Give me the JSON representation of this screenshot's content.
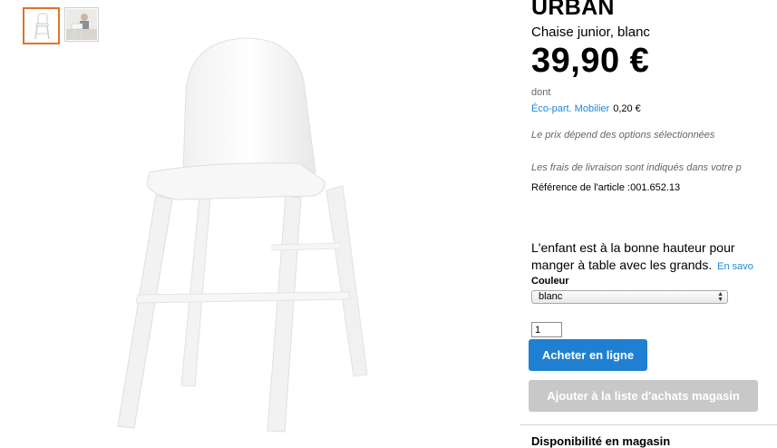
{
  "product": {
    "name": "URBAN",
    "subtitle": "Chaise junior, blanc",
    "price": "39,90 €"
  },
  "eco": {
    "dont": "dont",
    "link": "Éco-part. Mobilier",
    "value": "0,20 €"
  },
  "notes": {
    "price_options": "Le prix dépend des options sélectionnées",
    "shipping": "Les frais de livraison sont indiqués dans votre p"
  },
  "reference": "Référence de l'article :001.652.13",
  "description": {
    "line1": "L'enfant est à la bonne hauteur pour",
    "line2": "manger à table avec les grands.",
    "more_link": "En savo"
  },
  "color": {
    "label": "Couleur",
    "selected": "blanc"
  },
  "quantity": "1",
  "buttons": {
    "buy": "Acheter en ligne",
    "add_list": "Ajouter à la liste d'achats magasin"
  },
  "bottom": {
    "partial": "Disponibilité en magasin"
  },
  "icons": {
    "select_arrows": "updown-arrows-icon",
    "thumb_chair": "chair-thumbnail",
    "thumb_scene": "scene-thumbnail"
  },
  "colors": {
    "accent_blue": "#1f7fd1",
    "link_blue": "#1e88d6",
    "thumb_selected": "#e0732a",
    "disabled_gray": "#c8c8c8"
  }
}
